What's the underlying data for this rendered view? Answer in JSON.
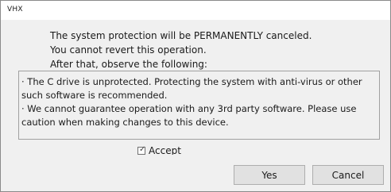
{
  "window": {
    "title": "VHX"
  },
  "message": {
    "line1": "The system protection will be PERMANENTLY canceled.",
    "line2": "You cannot revert this operation.",
    "line3": "After that, observe the following:"
  },
  "notice": {
    "item1": "· The C drive is unprotected. Protecting the system with anti-virus or other such software is recommended.",
    "item2": "· We cannot guarantee operation with any 3rd party software. Please use caution when making changes to this device."
  },
  "accept": {
    "label": "Accept",
    "checked": true
  },
  "buttons": {
    "yes": "Yes",
    "cancel": "Cancel"
  },
  "icons": {
    "checkmark": "check-icon"
  }
}
